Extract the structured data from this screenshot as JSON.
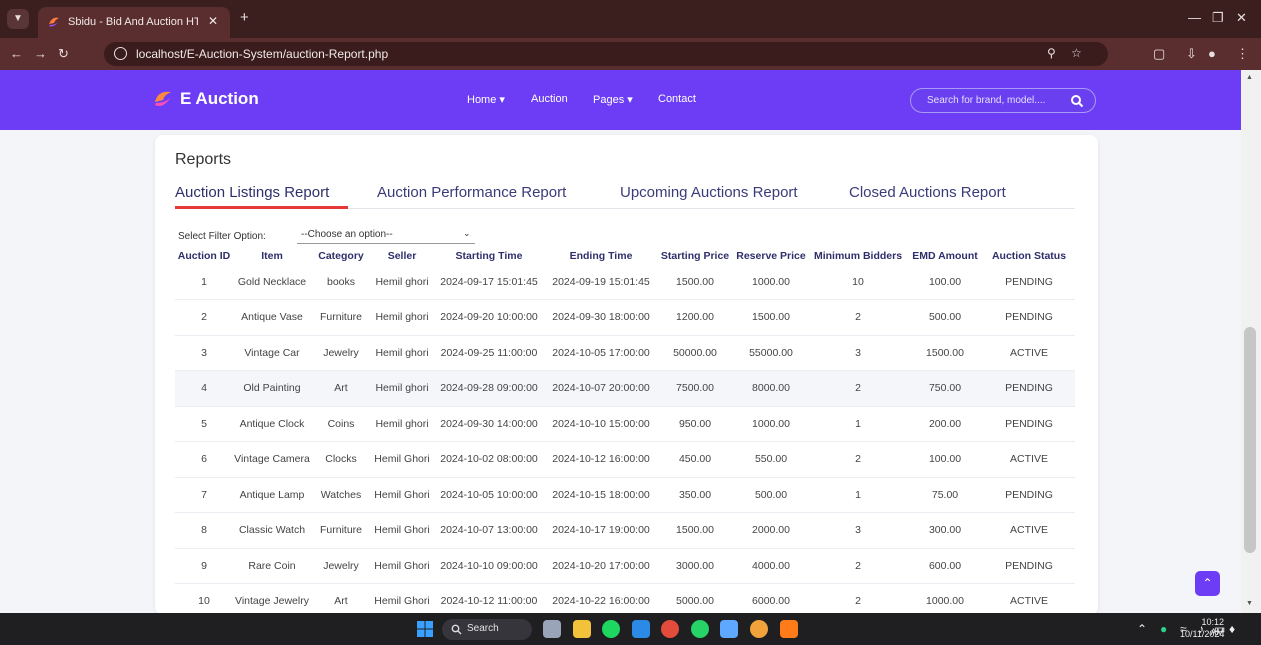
{
  "browser": {
    "tab_title": "Sbidu - Bid And Auction HTML",
    "url": "localhost/E-Auction-System/auction-Report.php"
  },
  "site": {
    "brand": "E Auction",
    "nav": [
      "Home",
      "Auction",
      "Pages",
      "Contact"
    ],
    "search_placeholder": "Search for brand, model....",
    "accent": "#6c3df5"
  },
  "report": {
    "title": "Reports",
    "tabs": [
      "Auction Listings Report",
      "Auction Performance Report",
      "Upcoming Auctions Report",
      "Closed Auctions Report"
    ],
    "active_tab": "Auction Listings Report",
    "filter_label": "Select Filter Option:",
    "filter_value": "--Choose an option--",
    "columns": [
      "Auction ID",
      "Item",
      "Category",
      "Seller",
      "Starting Time",
      "Ending Time",
      "Starting Price",
      "Reserve Price",
      "Minimum Bidders",
      "EMD Amount",
      "Auction Status"
    ],
    "rows": [
      [
        "1",
        "Gold Necklace",
        "books",
        "Hemil ghori",
        "2024-09-17 15:01:45",
        "2024-09-19 15:01:45",
        "1500.00",
        "1000.00",
        "10",
        "100.00",
        "PENDING"
      ],
      [
        "2",
        "Antique Vase",
        "Furniture",
        "Hemil ghori",
        "2024-09-20 10:00:00",
        "2024-09-30 18:00:00",
        "1200.00",
        "1500.00",
        "2",
        "500.00",
        "PENDING"
      ],
      [
        "3",
        "Vintage Car",
        "Jewelry",
        "Hemil ghori",
        "2024-09-25 11:00:00",
        "2024-10-05 17:00:00",
        "50000.00",
        "55000.00",
        "3",
        "1500.00",
        "ACTIVE"
      ],
      [
        "4",
        "Old Painting",
        "Art",
        "Hemil ghori",
        "2024-09-28 09:00:00",
        "2024-10-07 20:00:00",
        "7500.00",
        "8000.00",
        "2",
        "750.00",
        "PENDING"
      ],
      [
        "5",
        "Antique Clock",
        "Coins",
        "Hemil ghori",
        "2024-09-30 14:00:00",
        "2024-10-10 15:00:00",
        "950.00",
        "1000.00",
        "1",
        "200.00",
        "PENDING"
      ],
      [
        "6",
        "Vintage Camera",
        "Clocks",
        "Hemil Ghori",
        "2024-10-02 08:00:00",
        "2024-10-12 16:00:00",
        "450.00",
        "550.00",
        "2",
        "100.00",
        "ACTIVE"
      ],
      [
        "7",
        "Antique Lamp",
        "Watches",
        "Hemil Ghori",
        "2024-10-05 10:00:00",
        "2024-10-15 18:00:00",
        "350.00",
        "500.00",
        "1",
        "75.00",
        "PENDING"
      ],
      [
        "8",
        "Classic Watch",
        "Furniture",
        "Hemil Ghori",
        "2024-10-07 13:00:00",
        "2024-10-17 19:00:00",
        "1500.00",
        "2000.00",
        "3",
        "300.00",
        "ACTIVE"
      ],
      [
        "9",
        "Rare Coin",
        "Jewelry",
        "Hemil Ghori",
        "2024-10-10 09:00:00",
        "2024-10-20 17:00:00",
        "3000.00",
        "4000.00",
        "2",
        "600.00",
        "PENDING"
      ],
      [
        "10",
        "Vintage Jewelry",
        "Art",
        "Hemil Ghori",
        "2024-10-12 11:00:00",
        "2024-10-22 16:00:00",
        "5000.00",
        "6000.00",
        "2",
        "1000.00",
        "ACTIVE"
      ]
    ]
  },
  "taskbar": {
    "search_label": "Search",
    "time": "10:12 AM",
    "date": "10/11/2024"
  }
}
